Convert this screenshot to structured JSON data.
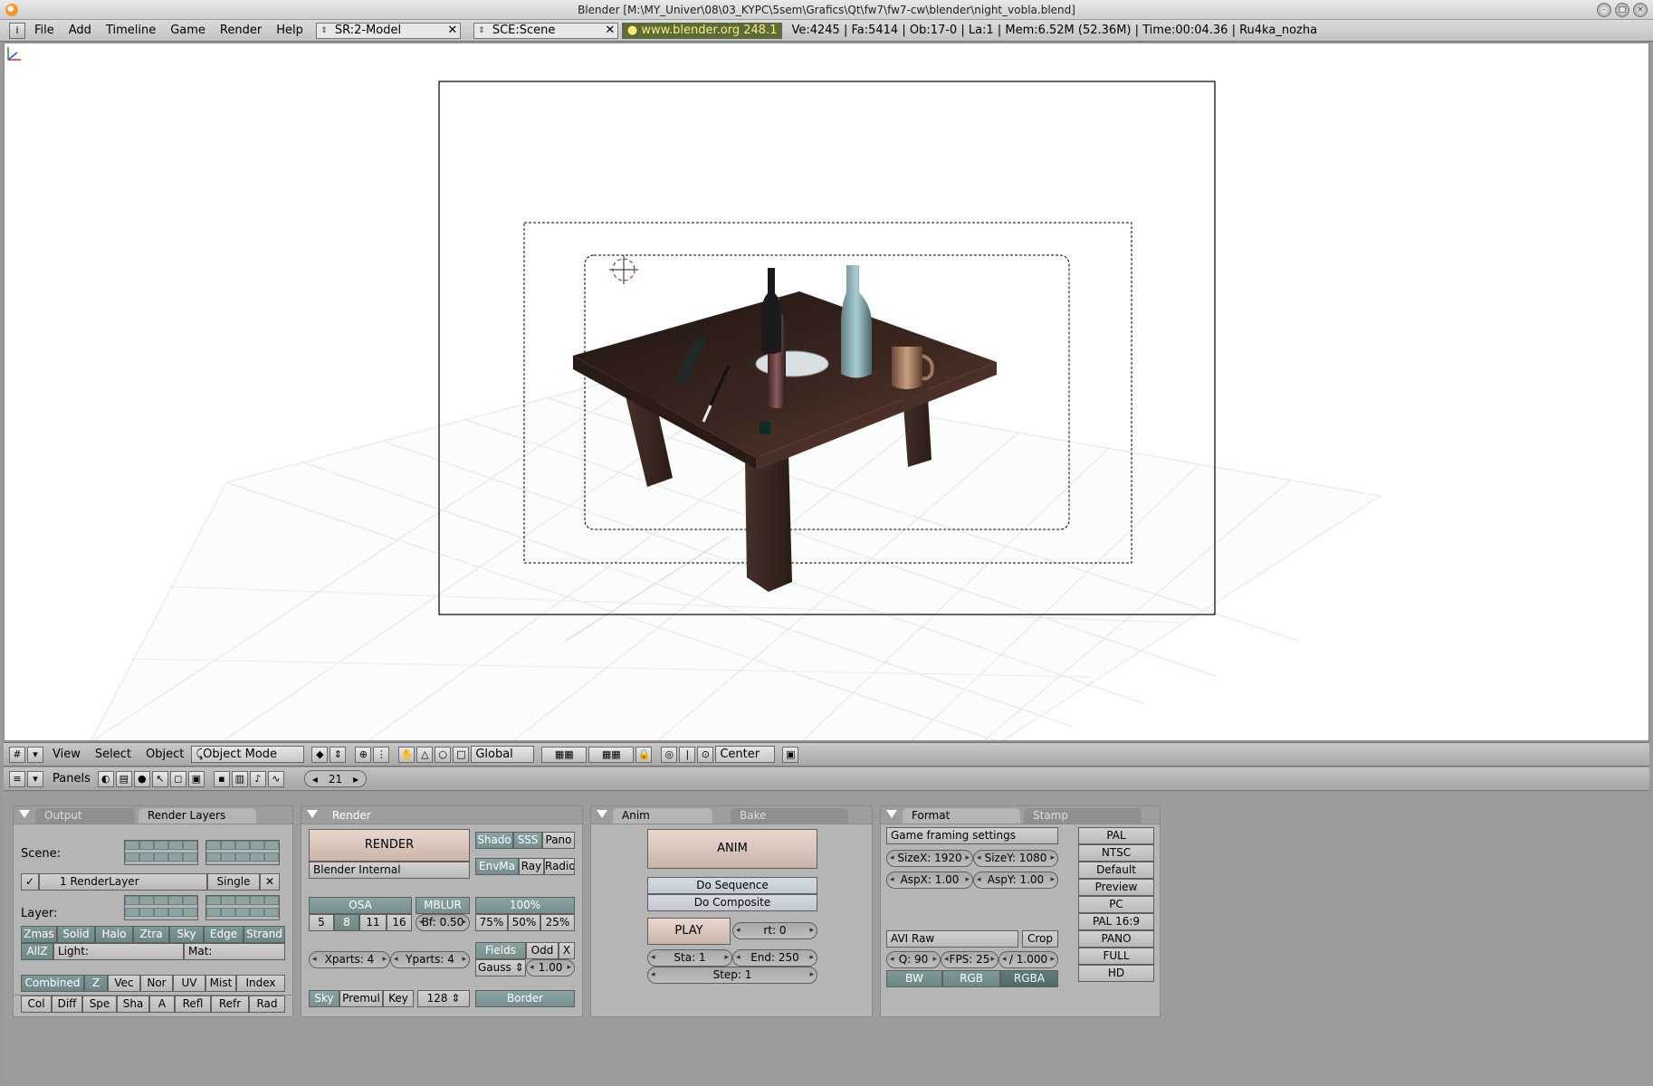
{
  "window": {
    "title": "Blender [M:\\MY_Univer\\08\\03_KYPC\\5sem\\Grafics\\Qt\\fw7\\fw7-cw\\blender\\night_vobla.blend]"
  },
  "infobar": {
    "menus": [
      "File",
      "Add",
      "Timeline",
      "Game",
      "Render",
      "Help"
    ],
    "screen": "SR:2-Model",
    "scene": "SCE:Scene",
    "link": "www.blender.org 248.1",
    "stats": "Ve:4245 | Fa:5414 | Ob:17-0 | La:1  | Mem:6.52M (52.36M)  | Time:00:04.36 | Ru4ka_nozha"
  },
  "view3d_header": {
    "menus": [
      "View",
      "Select",
      "Object"
    ],
    "mode": "Object Mode",
    "orientation": "Global",
    "pivot": "Center"
  },
  "buttons_header": {
    "label": "Panels",
    "frame": "21"
  },
  "panels": {
    "output_tab": "Output",
    "render_layers_tab": "Render Layers",
    "scene_label": "Scene:",
    "render_layer": "1 RenderLayer",
    "single": "Single",
    "layer_label": "Layer:",
    "layer_passes": [
      "Zmas",
      "Solid",
      "Halo",
      "Ztra",
      "Sky",
      "Edge",
      "Strand"
    ],
    "allz": "AllZ",
    "light_label": "Light:",
    "mat_label": "Mat:",
    "pass_row1": [
      "Combined",
      "Z",
      "Vec",
      "Nor",
      "UV",
      "Mist",
      "Index"
    ],
    "pass_row2": [
      "Col",
      "Diff",
      "Spe",
      "Sha",
      "A",
      "Refl",
      "Refr",
      "Rad"
    ],
    "render_tab": "Render",
    "render_btn": "RENDER",
    "engine": "Blender Internal",
    "shado": "Shado",
    "sss": "SSS",
    "pano": "Pano",
    "envma": "EnvMa",
    "ray": "Ray",
    "radio": "Radio",
    "osa": "OSA",
    "osa_levels": [
      "5",
      "8",
      "11",
      "16"
    ],
    "mblur": "MBLUR",
    "bf": "Bf: 0.50",
    "pct": [
      "100%",
      "75%",
      "50%",
      "25%"
    ],
    "xparts": "Xparts: 4",
    "yparts": "Yparts: 4",
    "fields": "Fields",
    "odd": "Odd",
    "x": "X",
    "gauss": "Gauss",
    "gauss_val": "1.00",
    "sky": "Sky",
    "premul": "Premul",
    "key": "Key",
    "bits": "128",
    "border": "Border",
    "anim_tab": "Anim",
    "bake_tab": "Bake",
    "anim_btn": "ANIM",
    "do_sequence": "Do Sequence",
    "do_composite": "Do Composite",
    "play": "PLAY",
    "rt": "rt: 0",
    "sta": "Sta: 1",
    "end": "End: 250",
    "step": "Step: 1",
    "format_tab": "Format",
    "stamp_tab": "Stamp",
    "game_framing": "Game framing settings",
    "sizex": "SizeX: 1920",
    "sizey": "SizeY: 1080",
    "aspx": "AspX: 1.00",
    "aspy": "AspY: 1.00",
    "codec": "AVI Raw",
    "crop": "Crop",
    "q": "Q: 90",
    "fps": "FPS: 25",
    "fps_base": "/ 1.000",
    "bw": "BW",
    "rgb": "RGB",
    "rgba": "RGBA",
    "presets": [
      "PAL",
      "NTSC",
      "Default",
      "Preview",
      "PC",
      "PAL 16:9",
      "PANO",
      "FULL",
      "HD"
    ]
  },
  "colors": {
    "active_toggle": "#7f9999",
    "render_button": "#cbb4a8",
    "panel_bg": "#b5b5b5"
  }
}
